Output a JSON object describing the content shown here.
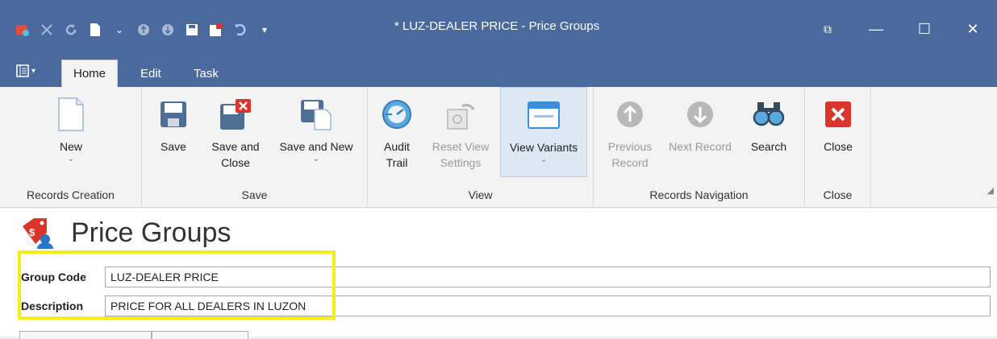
{
  "window": {
    "title": "* LUZ-DEALER PRICE - Price Groups",
    "controls": {
      "restore": "⧉",
      "minimize": "—",
      "maximize": "☐",
      "close": "✕"
    }
  },
  "quick_access": [
    "app-logo-icon",
    "cancel-icon",
    "refresh-icon",
    "new-doc-icon",
    "chevron-down-icon",
    "previous-icon",
    "next-icon",
    "save-icon",
    "save-close-icon",
    "undo-icon",
    "customize-icon"
  ],
  "menu": {
    "label": "▾"
  },
  "tabs": [
    {
      "label": "Home",
      "active": true
    },
    {
      "label": "Edit",
      "active": false
    },
    {
      "label": "Task",
      "active": false
    }
  ],
  "ribbon": {
    "groups": [
      {
        "label": "Records Creation",
        "buttons": [
          {
            "label": "New",
            "chevron": "⌄",
            "icon": "new-document-icon"
          }
        ]
      },
      {
        "label": "Save",
        "buttons": [
          {
            "label": "Save",
            "icon": "save-icon"
          },
          {
            "label": "Save and Close",
            "line1": "Save and",
            "line2": "Close",
            "icon": "save-close-icon"
          },
          {
            "label": "Save and New",
            "chevron": "⌄",
            "icon": "save-new-icon"
          }
        ]
      },
      {
        "label": "View",
        "buttons": [
          {
            "label": "Audit Trail",
            "line1": "Audit",
            "line2": "Trail",
            "icon": "audit-trail-icon"
          },
          {
            "label": "Reset View Settings",
            "line1": "Reset View",
            "line2": "Settings",
            "icon": "reset-view-icon",
            "disabled": true
          },
          {
            "label": "View Variants",
            "chevron": "⌄",
            "icon": "view-variants-icon",
            "selected": true
          }
        ]
      },
      {
        "label": "Records Navigation",
        "buttons": [
          {
            "label": "Previous Record",
            "line1": "Previous",
            "line2": "Record",
            "icon": "previous-record-icon",
            "disabled": true
          },
          {
            "label": "Next Record",
            "icon": "next-record-icon",
            "disabled": true
          },
          {
            "label": "Search",
            "icon": "search-icon"
          }
        ]
      },
      {
        "label": "Close",
        "buttons": [
          {
            "label": "Close",
            "icon": "close-icon"
          }
        ]
      }
    ]
  },
  "page": {
    "title": "Price Groups",
    "icon": "price-group-icon",
    "fields": [
      {
        "label": "Group Code",
        "value": "LUZ-DEALER PRICE"
      },
      {
        "label": "Description",
        "value": "PRICE FOR ALL DEALERS IN LUZON"
      }
    ]
  },
  "colors": {
    "titlebar": "#4a6a9d",
    "highlight": "#f5ef18",
    "close_red": "#d9352a"
  }
}
